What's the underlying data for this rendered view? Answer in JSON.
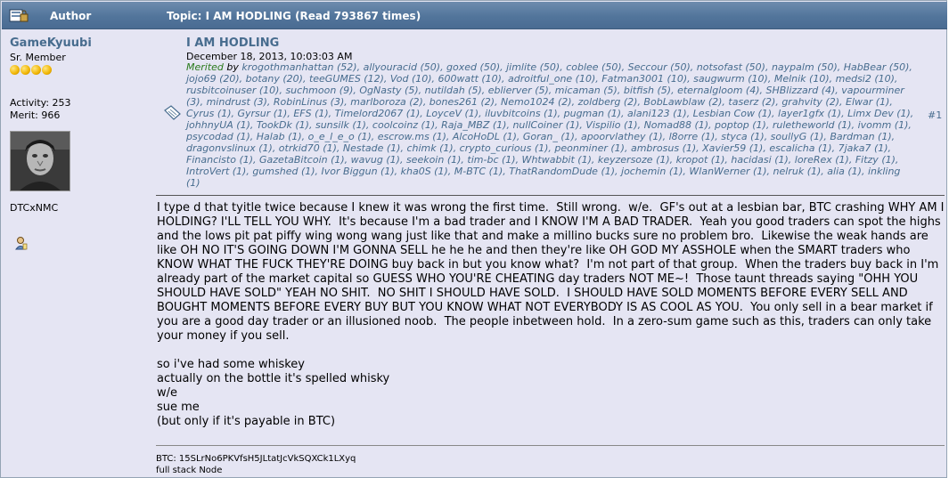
{
  "header": {
    "author_label": "Author",
    "topic_label": "Topic: I AM HODLING  (Read 793867 times)"
  },
  "poster": {
    "name": "GameKyuubi",
    "rank": "Sr. Member",
    "stars": 4,
    "activity": "Activity: 253",
    "merit": "Merit: 966",
    "personal_text": "DTCxNMC"
  },
  "post": {
    "title": "I AM HODLING",
    "date": "December 18, 2013, 10:03:03 AM",
    "merited_label": "Merited",
    "merited_by": " by ",
    "merits": "krogothmanhattan (52), allyouracid (50), goxed (50), jimlite (50), coblee (50), Seccour (50), notsofast (50), naypalm (50), HabBear (50), jojo69 (20), botany (20), teeGUMES (12), Vod (10), 600watt (10), adroitful_one (10), Fatman3001 (10), saugwurm (10), Melnik (10), medsi2 (10), rusbitcoinuser (10), suchmoon (9), OgNasty (5), nutildah (5), eblierver (5), micaman (5), bitfish (5), eternalgloom (4), SHBlizzard (4), vapourminer (3), mindrust (3), RobinLinus (3), marlboroza (2), bones261 (2), Nemo1024 (2), zoldberg (2), BobLawblaw (2), taserz (2), grahvity (2), Elwar (1), Cyrus (1), Gyrsur (1), EFS (1), Timelord2067 (1), LoyceV (1), iluvbitcoins (1), pugman (1), alani123 (1), Lesbian Cow (1), layer1gfx (1), Limx Dev (1), johhnyUA (1), TookDk (1), sunsilk (1), coolcoinz (1), Raja_MBZ (1), nullCoiner (1), Vispilio (1), Nomad88 (1), poptop (1), ruletheworld (1), ivomm (1), psycodad (1), Halab (1), o_e_l_e_o (1), escrow.ms (1), AlcoHoDL (1), Goran_ (1), apoorvlathey (1), l8orre (1), styca (1), soullyG (1), Bardman (1), dragonvslinux (1), otrkid70 (1), Nestade (1), chimk (1), crypto_curious (1), peonminer (1), ambrosus (1), Xavier59 (1), escalicha (1), 7jaka7 (1), Financisto (1), GazetaBitcoin (1), wavug (1), seekoin (1), tim-bc (1), Whtwabbit (1), keyzersoze (1), kropot (1), hacidasi (1), loreRex (1), Fitzy (1), IntroVert (1), gumshed (1), Ivor Biggun (1), kha0S (1), M-BTC (1), ThatRandomDude (1), jochemin (1), WlanWerner (1), nelruk (1), alia (1), inkling (1)",
    "number": "#1",
    "body": "I type d that tyitle twice because I knew it was wrong the first time.  Still wrong.  w/e.  GF's out at a lesbian bar, BTC crashing WHY AM I HOLDING? I'LL TELL YOU WHY.  It's because I'm a bad trader and I KNOW I'M A BAD TRADER.  Yeah you good traders can spot the highs and the lows pit pat piffy wing wong wang just like that and make a millino bucks sure no problem bro.  Likewise the weak hands are like OH NO IT'S GOING DOWN I'M GONNA SELL he he he and then they're like OH GOD MY ASSHOLE when the SMART traders who KNOW WHAT THE FUCK THEY'RE DOING buy back in but you know what?  I'm not part of that group.  When the traders buy back in I'm already part of the market capital so GUESS WHO YOU'RE CHEATING day traders NOT ME~!  Those taunt threads saying \"OHH YOU SHOULD HAVE SOLD\" YEAH NO SHIT.  NO SHIT I SHOULD HAVE SOLD.  I SHOULD HAVE SOLD MOMENTS BEFORE EVERY SELL AND BOUGHT MOMENTS BEFORE EVERY BUY BUT YOU KNOW WHAT NOT EVERYBODY IS AS COOL AS YOU.  You only sell in a bear market if you are a good day trader or an illusioned noob.  The people inbetween hold.  In a zero-sum game such as this, traders can only take your money if you sell.\n\nso i've had some whiskey\nactually on the bottle it's spelled whisky\nw/e\nsue me\n(but only if it's payable in BTC)",
    "signature_line1": "BTC: 15SLrNo6PKVfsH5JLtatJcVkSQXCk1LXyq",
    "signature_line2": "full stack Node"
  },
  "icons": {
    "header": "forum-author-icon",
    "quote": "quote-icon",
    "profile": "profile-icon"
  }
}
